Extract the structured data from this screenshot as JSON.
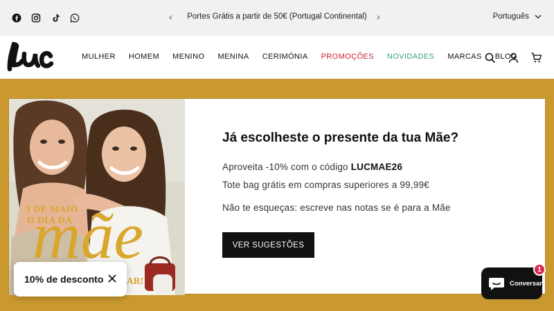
{
  "topbar": {
    "social_icons": [
      "facebook-icon",
      "instagram-icon",
      "tiktok-icon",
      "whatsapp-icon"
    ],
    "announcement": "Portes Grátis a partir de 50€ (Portugal Continental)",
    "language": "Português"
  },
  "header": {
    "logo_text": "Luc",
    "nav": [
      {
        "label": "MULHER"
      },
      {
        "label": "HOMEM"
      },
      {
        "label": "MENINO"
      },
      {
        "label": "MENINA"
      },
      {
        "label": "CERIMÓNIA"
      },
      {
        "label": "PROMOÇÕES",
        "color": "#d1203a"
      },
      {
        "label": "NOVIDADES",
        "color": "#3aa37a"
      },
      {
        "label": "MARCAS"
      },
      {
        "label": "BLOG"
      }
    ],
    "icons": [
      "search-icon",
      "account-icon",
      "cart-icon"
    ]
  },
  "hero": {
    "background_color": "#c9992f",
    "image": {
      "text_line1": "3 DE MAIO",
      "text_line2": "O DIA DA",
      "script_word": "mãe",
      "text_tail": "AR!"
    },
    "headline": "Já escolheste o presente da tua Mãe?",
    "line1_prefix": "Aproveita -10% com o código ",
    "line1_code": "LUCMAE26",
    "line2": "Tote bag grátis em compras superiores a 99,99€",
    "line3": "Não te esqueças: escreve nas notas se é para a Mãe",
    "cta_label": "VER SUGESTÕES"
  },
  "discount_popup": {
    "label": "10% de desconto"
  },
  "chat": {
    "label": "Conversar",
    "badge_count": "1"
  }
}
